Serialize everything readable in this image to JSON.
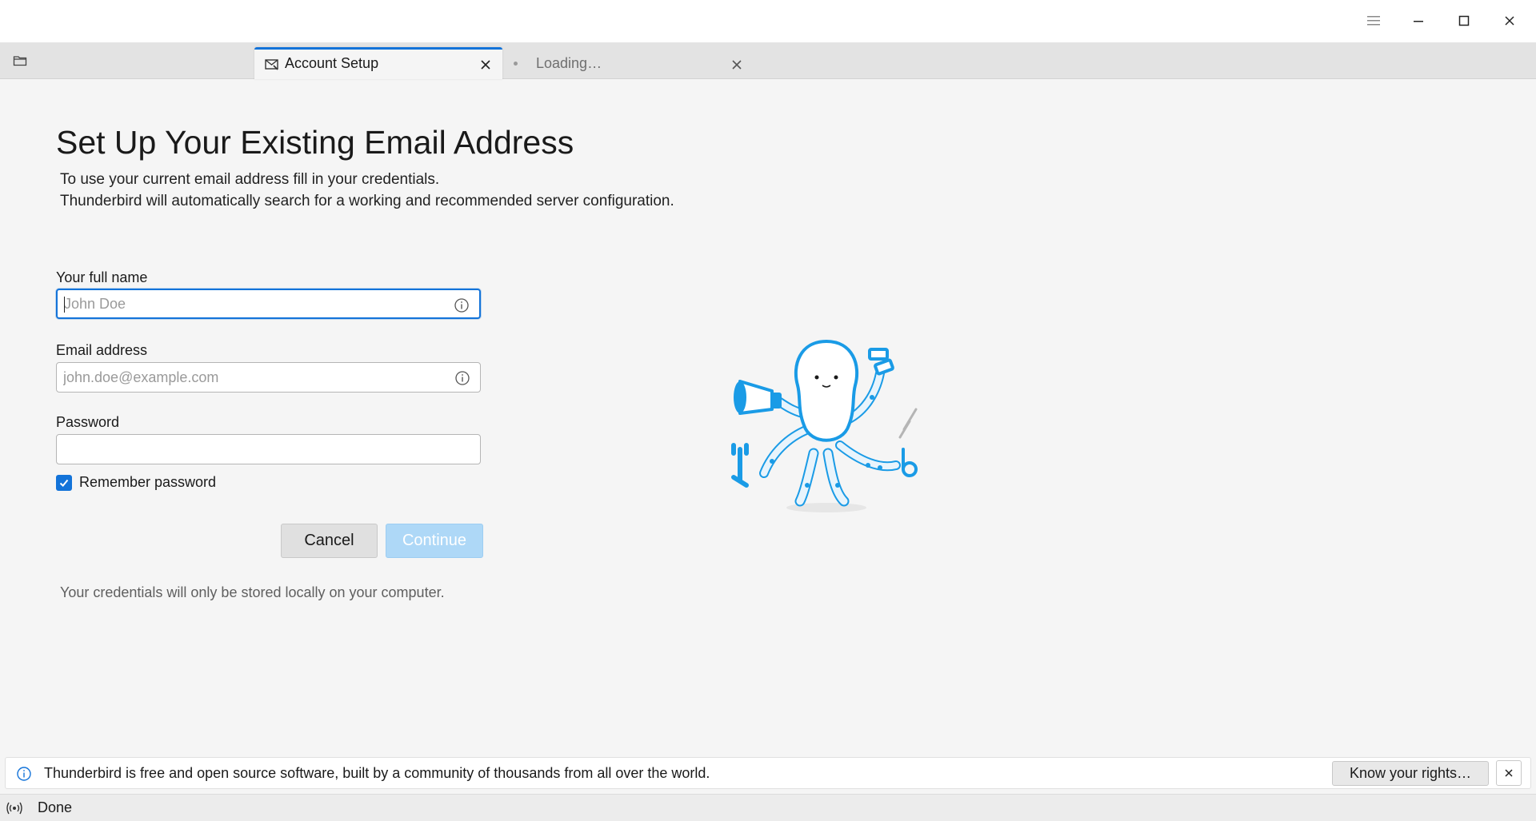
{
  "window": {
    "controls": [
      "menu-icon",
      "minimize-icon",
      "maximize-icon",
      "close-icon"
    ]
  },
  "tabs": [
    {
      "label": "Account Setup",
      "icon": "mail-setup-icon",
      "active": true
    },
    {
      "label": "Loading…",
      "active": false
    }
  ],
  "setup": {
    "title": "Set Up Your Existing Email Address",
    "description_line1": "To use your current email address fill in your credentials.",
    "description_line2": "Thunderbird will automatically search for a working and recommended server configuration.",
    "full_name": {
      "label": "Your full name",
      "placeholder": "John Doe",
      "value": ""
    },
    "email": {
      "label": "Email address",
      "placeholder": "john.doe@example.com",
      "value": ""
    },
    "password": {
      "label": "Password",
      "value": ""
    },
    "remember_password": {
      "label": "Remember password",
      "checked": true
    },
    "cancel_label": "Cancel",
    "continue_label": "Continue",
    "note": "Your credentials will only be stored locally on your computer."
  },
  "notification": {
    "text": "Thunderbird is free and open source software, built by a community of thousands from all over the world.",
    "button_label": "Know your rights…"
  },
  "status": {
    "text": "Done"
  },
  "colors": {
    "accent": "#1373d9",
    "continue_disabled": "#aed8f7",
    "mascot_blue": "#1a9be6"
  }
}
